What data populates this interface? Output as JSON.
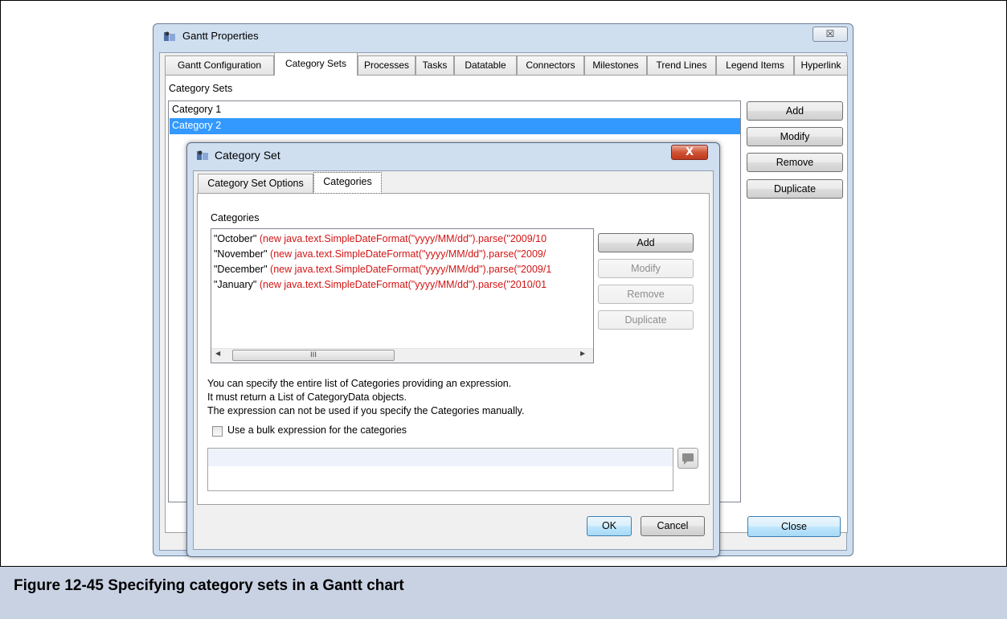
{
  "outer_window": {
    "title": "Gantt Properties",
    "close_label": "☒",
    "tabs": [
      "Gantt Configuration",
      "Category Sets",
      "Processes",
      "Tasks",
      "Datatable",
      "Connectors",
      "Milestones",
      "Trend Lines",
      "Legend Items",
      "Hyperlink"
    ],
    "active_tab": "Category Sets",
    "section_label": "Category Sets",
    "list_items": [
      "Category 1",
      "Category 2"
    ],
    "selected_item": "Category 2",
    "buttons": {
      "add": "Add",
      "modify": "Modify",
      "remove": "Remove",
      "duplicate": "Duplicate",
      "close": "Close"
    }
  },
  "inner_dialog": {
    "title": "Category Set",
    "close_label": "X",
    "tabs": [
      "Category Set Options",
      "Categories"
    ],
    "active_tab": "Categories",
    "section_label": "Categories",
    "categories": [
      {
        "name": "\"October\"",
        "expr": "(new java.text.SimpleDateFormat(\"yyyy/MM/dd\").parse(\"2009/10"
      },
      {
        "name": "\"November\"",
        "expr": "(new java.text.SimpleDateFormat(\"yyyy/MM/dd\").parse(\"2009/"
      },
      {
        "name": "\"December\"",
        "expr": "(new java.text.SimpleDateFormat(\"yyyy/MM/dd\").parse(\"2009/1"
      },
      {
        "name": "\"January\"",
        "expr": "(new java.text.SimpleDateFormat(\"yyyy/MM/dd\").parse(\"2010/01"
      }
    ],
    "scroll_left": "◀",
    "scroll_right": "▶",
    "scroll_thumb": "III",
    "buttons": {
      "add": "Add",
      "modify": "Modify",
      "remove": "Remove",
      "duplicate": "Duplicate",
      "ok": "OK",
      "cancel": "Cancel"
    },
    "help_lines": [
      "You can specify the entire list of Categories providing an expression.",
      "It must return a List of CategoryData objects.",
      "The expression can not be used if you specify the Categories manually."
    ],
    "checkbox_label": "Use a bulk expression for the categories",
    "checkbox_checked": false
  },
  "caption": "Figure 12-45  Specifying category sets in a Gantt chart",
  "colors": {
    "selection": "#3399ff",
    "expression_text": "#d21414",
    "caption_bg": "#c9d2e3"
  }
}
